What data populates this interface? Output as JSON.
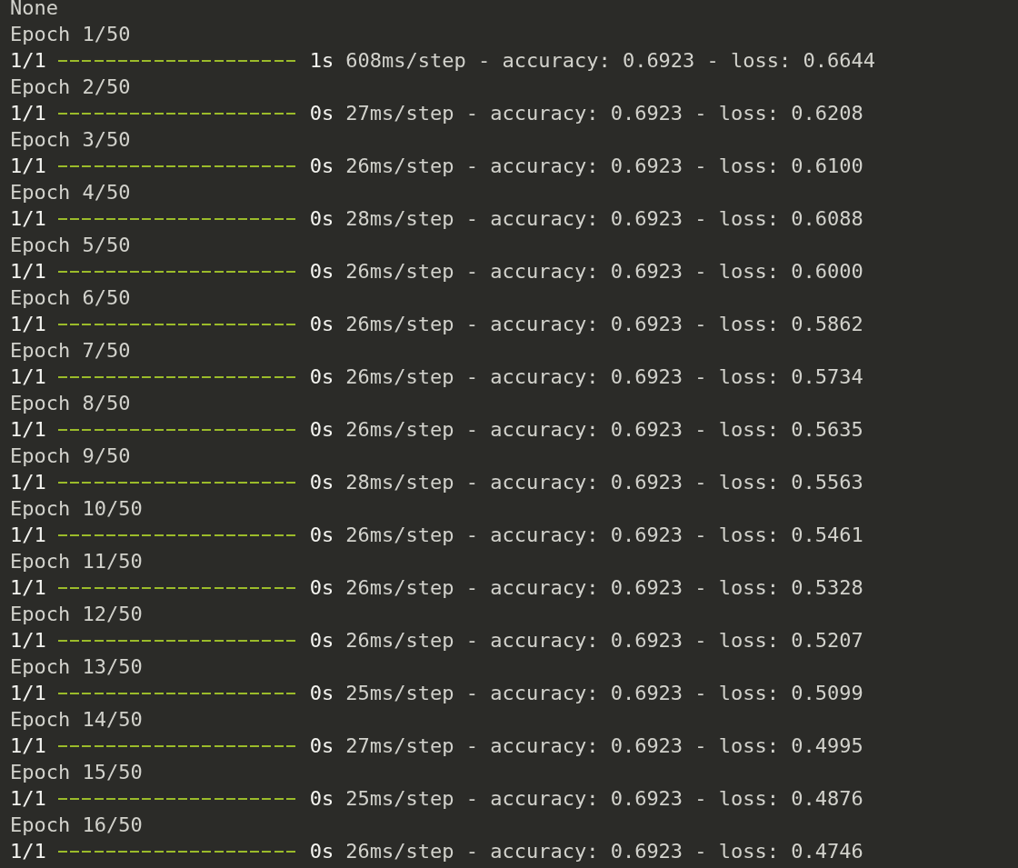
{
  "console": {
    "first_line": "None",
    "epochs": [
      {
        "header": "Epoch 1/50",
        "steps": "1/1",
        "level": 1,
        "time": "1s",
        "metrics": "608ms/step - accuracy: 0.6923 - loss: 0.6644"
      },
      {
        "header": "Epoch 2/50",
        "steps": "1/1",
        "level": 1,
        "time": "0s",
        "metrics": "27ms/step - accuracy: 0.6923 - loss: 0.6208"
      },
      {
        "header": "Epoch 3/50",
        "steps": "1/1",
        "level": 1,
        "time": "0s",
        "metrics": "26ms/step - accuracy: 0.6923 - loss: 0.6100"
      },
      {
        "header": "Epoch 4/50",
        "steps": "1/1",
        "level": 1,
        "time": "0s",
        "metrics": "28ms/step - accuracy: 0.6923 - loss: 0.6088"
      },
      {
        "header": "Epoch 5/50",
        "steps": "1/1",
        "level": 1,
        "time": "0s",
        "metrics": "26ms/step - accuracy: 0.6923 - loss: 0.6000"
      },
      {
        "header": "Epoch 6/50",
        "steps": "1/1",
        "level": 1,
        "time": "0s",
        "metrics": "26ms/step - accuracy: 0.6923 - loss: 0.5862"
      },
      {
        "header": "Epoch 7/50",
        "steps": "1/1",
        "level": 1,
        "time": "0s",
        "metrics": "26ms/step - accuracy: 0.6923 - loss: 0.5734"
      },
      {
        "header": "Epoch 8/50",
        "steps": "1/1",
        "level": 1,
        "time": "0s",
        "metrics": "26ms/step - accuracy: 0.6923 - loss: 0.5635"
      },
      {
        "header": "Epoch 9/50",
        "steps": "1/1",
        "level": 1,
        "time": "0s",
        "metrics": "28ms/step - accuracy: 0.6923 - loss: 0.5563"
      },
      {
        "header": "Epoch 10/50",
        "steps": "1/1",
        "level": 1,
        "time": "0s",
        "metrics": "26ms/step - accuracy: 0.6923 - loss: 0.5461"
      },
      {
        "header": "Epoch 11/50",
        "steps": "1/1",
        "level": 1,
        "time": "0s",
        "metrics": "26ms/step - accuracy: 0.6923 - loss: 0.5328"
      },
      {
        "header": "Epoch 12/50",
        "steps": "1/1",
        "level": 1,
        "time": "0s",
        "metrics": "26ms/step - accuracy: 0.6923 - loss: 0.5207"
      },
      {
        "header": "Epoch 13/50",
        "steps": "1/1",
        "level": 1,
        "time": "0s",
        "metrics": "25ms/step - accuracy: 0.6923 - loss: 0.5099"
      },
      {
        "header": "Epoch 14/50",
        "steps": "1/1",
        "level": 1,
        "time": "0s",
        "metrics": "27ms/step - accuracy: 0.6923 - loss: 0.4995"
      },
      {
        "header": "Epoch 15/50",
        "steps": "1/1",
        "level": 1,
        "time": "0s",
        "metrics": "25ms/step - accuracy: 0.6923 - loss: 0.4876"
      },
      {
        "header": "Epoch 16/50",
        "steps": "1/1",
        "level": 1,
        "time": "0s",
        "metrics": "26ms/step - accuracy: 0.6923 - loss: 0.4746"
      }
    ]
  }
}
